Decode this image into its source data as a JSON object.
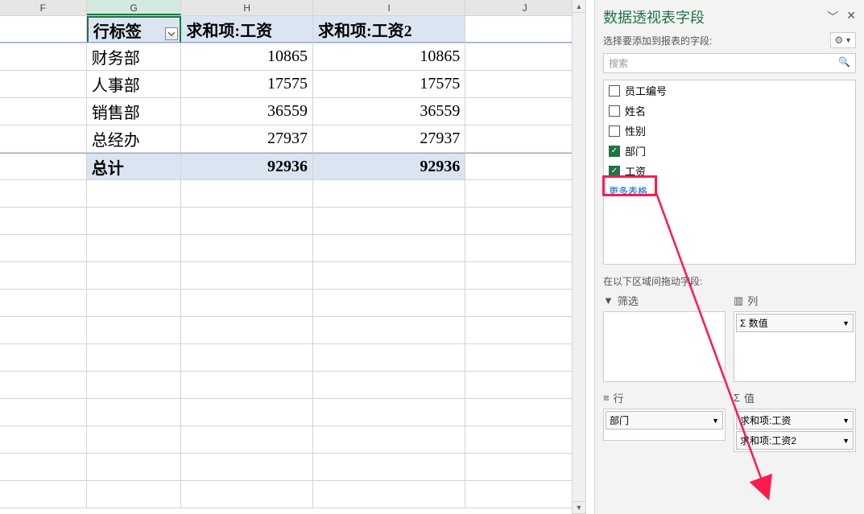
{
  "columns": {
    "F": "F",
    "G": "G",
    "H": "H",
    "I": "I",
    "J": "J"
  },
  "pivot": {
    "row_label_header": "行标签",
    "sum_col1": "求和项:工资",
    "sum_col2": "求和项:工资2",
    "rows": [
      {
        "label": "财务部",
        "v1": "10865",
        "v2": "10865"
      },
      {
        "label": "人事部",
        "v1": "17575",
        "v2": "17575"
      },
      {
        "label": "销售部",
        "v1": "36559",
        "v2": "36559"
      },
      {
        "label": "总经办",
        "v1": "27937",
        "v2": "27937"
      }
    ],
    "total_label": "总计",
    "total_v1": "92936",
    "total_v2": "92936"
  },
  "panel": {
    "title": "数据透视表字段",
    "subtitle": "选择要添加到报表的字段:",
    "search_placeholder": "搜索",
    "fields": [
      {
        "label": "员工编号",
        "checked": false
      },
      {
        "label": "姓名",
        "checked": false
      },
      {
        "label": "性别",
        "checked": false
      },
      {
        "label": "部门",
        "checked": true
      },
      {
        "label": "工资",
        "checked": true
      }
    ],
    "more_tables": "更多表格...",
    "drag_label": "在以下区域间拖动字段:",
    "area_filter": "筛选",
    "area_columns": "列",
    "area_rows": "行",
    "area_values": "值",
    "columns_items": [
      "Σ 数值"
    ],
    "rows_items": [
      "部门"
    ],
    "values_items": [
      "求和项:工资",
      "求和项:工资2"
    ]
  }
}
